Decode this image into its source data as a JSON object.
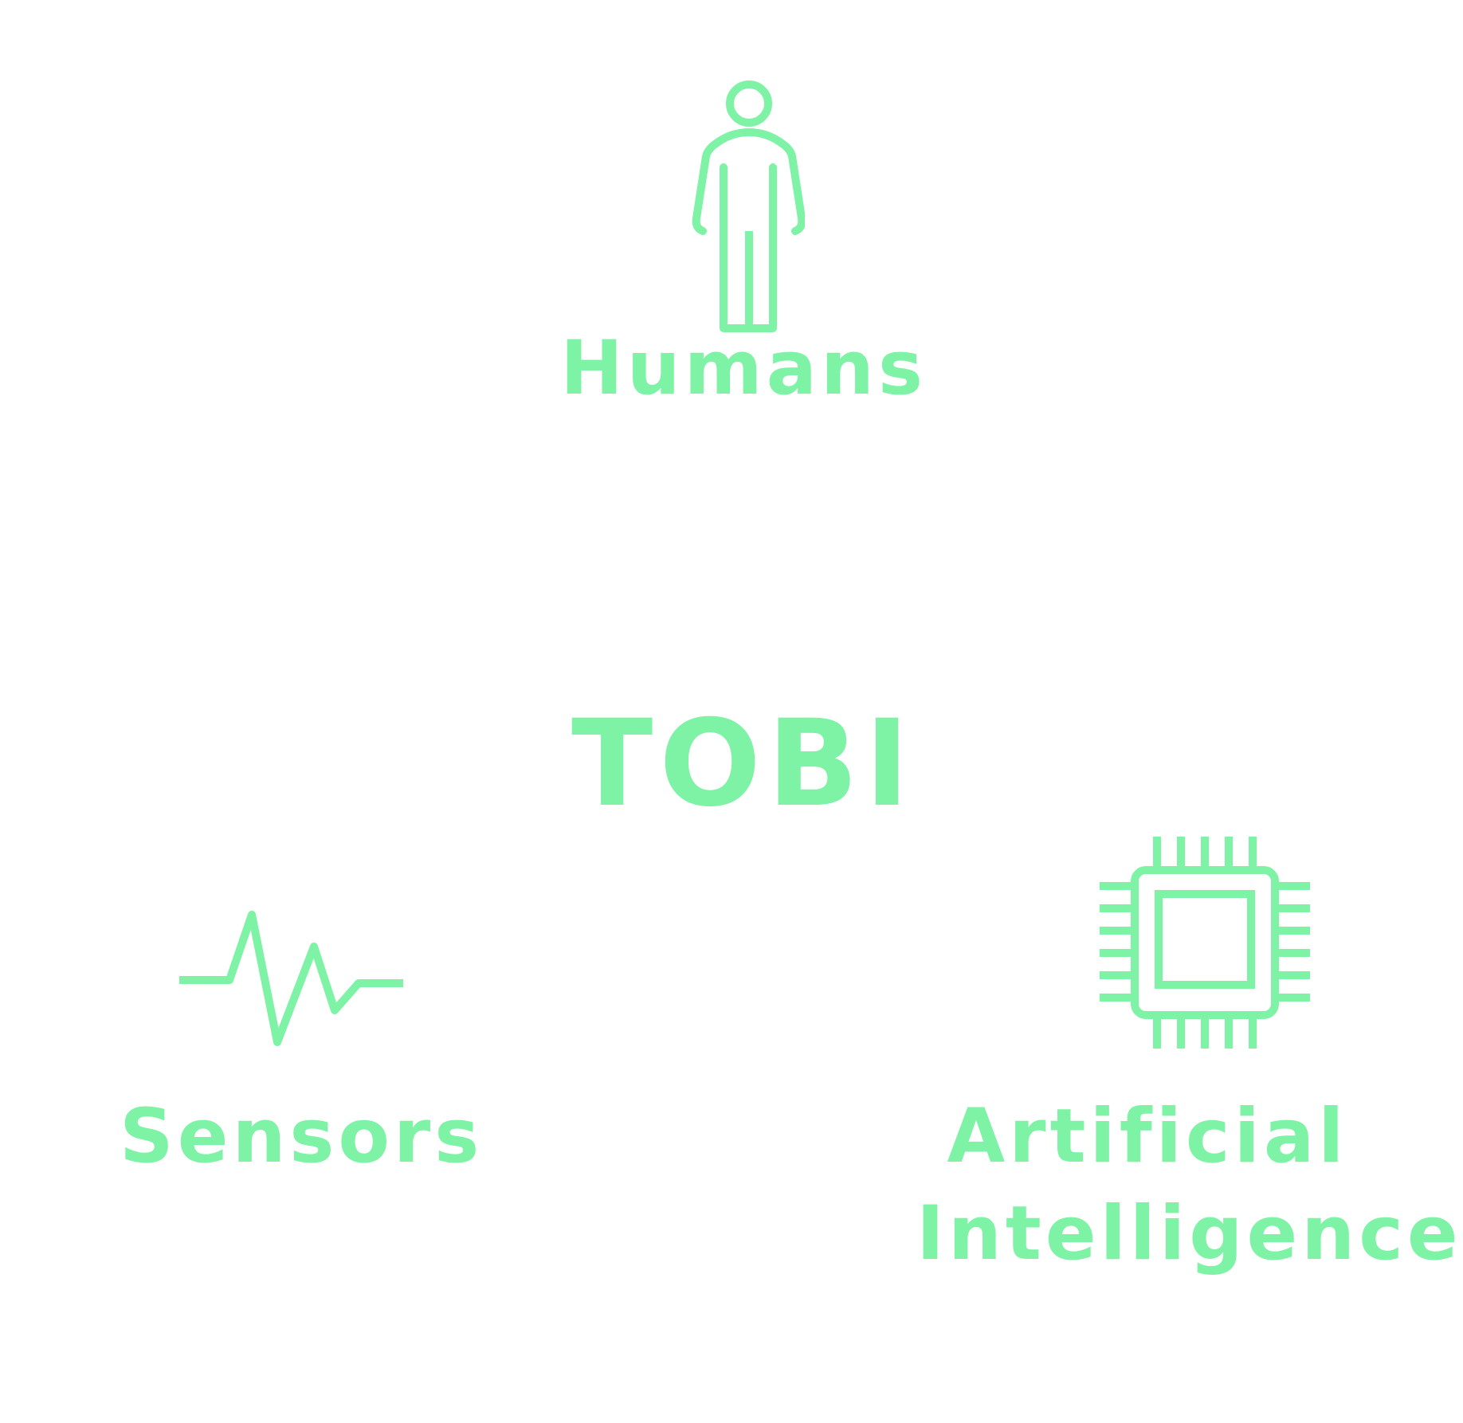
{
  "accent_color": "#7ef3a6",
  "center": {
    "title": "TOBI"
  },
  "nodes": {
    "humans": {
      "label": "Humans",
      "icon": "person-icon"
    },
    "sensors": {
      "label": "Sensors",
      "icon": "pulse-waveform-icon"
    },
    "ai": {
      "label_line1": "Artificial",
      "label_line2": "Intelligence",
      "icon": "cpu-chip-icon"
    }
  }
}
